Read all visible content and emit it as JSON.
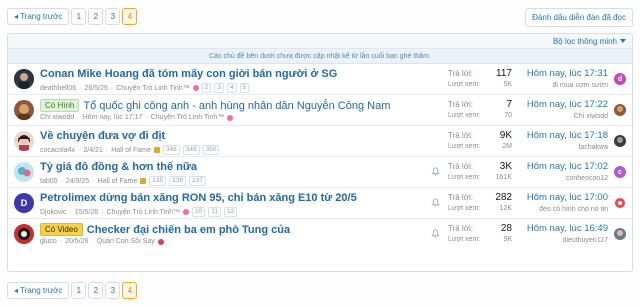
{
  "pagination": {
    "prev_label": "◂ Trang trước",
    "pages": [
      "1",
      "2",
      "3",
      "4"
    ],
    "current": "4"
  },
  "mark_read_label": "Đánh dấu diễn đàn đã đọc",
  "filter": {
    "label": "Bộ lọc thông minh"
  },
  "notice": "Các chủ đề bên dưới chưa được cập nhật kể từ lần cuối bạn ghé thăm.",
  "stats_labels": {
    "replies": "Trả lời:",
    "views": "Lượt xem:"
  },
  "threads": [
    {
      "title": "Conan Mike Hoang đã tóm mấy con giời bán người ở SG",
      "prefix": "",
      "author": "deathhell06",
      "date": "26/5/26",
      "forum": "Chuyện Trò Linh Tinh™",
      "pages": [
        "2",
        "3",
        "4",
        "5"
      ],
      "replies": "117",
      "views": "5K",
      "latest_time": "Hôm nay, lúc 17:31",
      "latest_user": "đi mua cơm sườn",
      "avatar_initial": "",
      "latest_avatar": "d",
      "watched": false
    },
    {
      "title": "Tổ quốc ghi công anh - anh hùng nhân dân Nguyễn Công Nam",
      "prefix": "Có Hình",
      "author": "Chi xiwodd",
      "date": "Hôm nay, lúc 17:17",
      "forum": "Chuyện Trò Linh Tinh™",
      "pages": [],
      "replies": "7",
      "views": "70",
      "latest_time": "Hôm nay, lúc 17:22",
      "latest_user": "Chi xiwodd",
      "avatar_initial": "",
      "latest_avatar": "",
      "watched": false
    },
    {
      "title": "Về chuyện đưa vợ đi địt",
      "prefix": "",
      "author": "cocacola4x",
      "date": "2/4/21",
      "forum": "Hall of Fame",
      "pages": [
        "348",
        "349",
        "350"
      ],
      "replies": "9K",
      "views": "2M",
      "latest_time": "Hôm nay, lúc 17:18",
      "latest_user": "fachakwa",
      "avatar_initial": "",
      "latest_avatar": "",
      "watched": false
    },
    {
      "title": "Tỷ giá đô đồng & hơn thế nữa",
      "prefix": "",
      "author": "tab00",
      "date": "24/9/25",
      "forum": "Hall of Fame",
      "pages": [
        "135",
        "136",
        "137"
      ],
      "replies": "3K",
      "views": "161K",
      "latest_time": "Hôm nay, lúc 17:02",
      "latest_user": "conheocon12",
      "avatar_initial": "",
      "latest_avatar": "c",
      "watched": true
    },
    {
      "title": "Petrolimex dừng bán xăng RON 95, chỉ bán xăng E10 từ 20/5",
      "prefix": "",
      "author": "Djokovic",
      "date": "15/5/26",
      "forum": "Chuyện Trò Linh Tinh™",
      "pages": [
        "10",
        "11",
        "12"
      ],
      "replies": "282",
      "views": "12K",
      "latest_time": "Hôm nay, lúc 17:00",
      "latest_user": "đéo có hình chó nó tin",
      "avatar_initial": "D",
      "latest_avatar": "",
      "watched": true
    },
    {
      "title": "Checker đại chiến ba em phò Tung của",
      "prefix": "Có Video",
      "author": "gluco",
      "date": "20/5/26",
      "forum": "Quán Con Sõi Say",
      "pages": [],
      "replies": "28",
      "views": "9K",
      "latest_time": "Hôm nay, lúc 16:49",
      "latest_user": "dieuthuyen117",
      "avatar_initial": "",
      "latest_avatar": "",
      "watched": true
    }
  ],
  "colors": {
    "link": "#2269a6",
    "current_page": "#f5a623",
    "prefix_green": "#dff3d9",
    "prefix_yellow": "#f7d04a"
  },
  "icons": [
    "caret-down-icon",
    "bell-icon",
    "trophy-icon",
    "heart-emoji-icon"
  ]
}
